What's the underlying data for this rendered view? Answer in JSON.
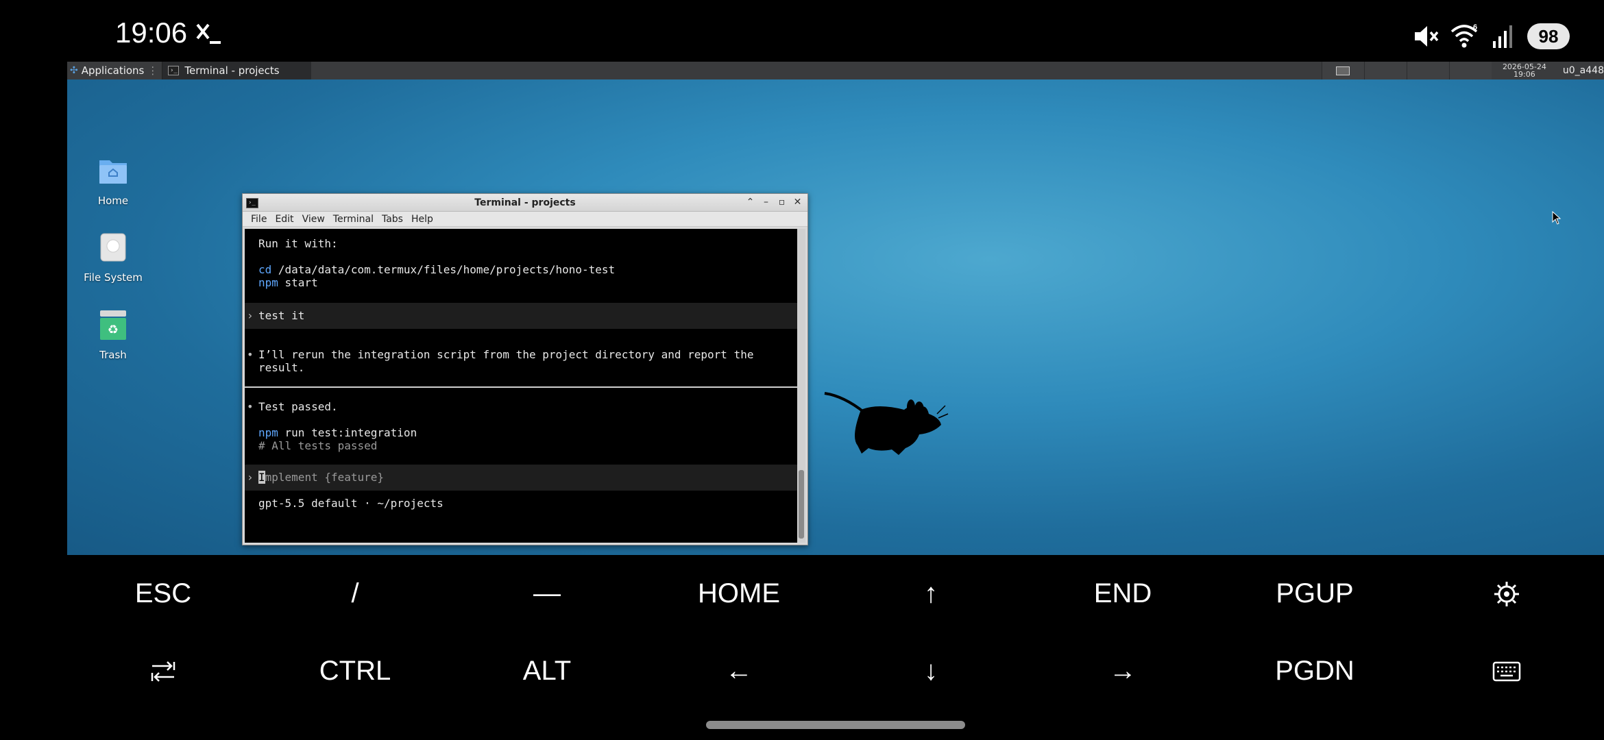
{
  "status_bar": {
    "time": "19:06",
    "battery": "98"
  },
  "panel": {
    "applications_label": "Applications",
    "task_label": "Terminal - projects",
    "clock_date": "2026-05-24",
    "clock_time": "19:06",
    "user": "u0_a448"
  },
  "desktop_icons": [
    {
      "label": "Home"
    },
    {
      "label": "File System"
    },
    {
      "label": "Trash"
    }
  ],
  "window": {
    "title": "Terminal - projects",
    "menu": [
      "File",
      "Edit",
      "View",
      "Terminal",
      "Tabs",
      "Help"
    ]
  },
  "terminal": {
    "run_it_with": "Run it with:",
    "cd_cmd": "cd",
    "cd_path": " /data/data/com.termux/files/home/projects/hono-test",
    "npm_cmd": "npm",
    "npm_start": " start",
    "prompt1_arrow": "›",
    "prompt1_text": "test it",
    "bullet": "•",
    "reply1_line1": "I’ll rerun the integration script from the project directory and report the",
    "reply1_line2": "result.",
    "reply2": "Test passed.",
    "npm_cmd2": "npm",
    "npm_run": " run test:integration",
    "comment": "# All tests passed",
    "prompt2_arrow": "›",
    "input_cursor": "I",
    "input_placeholder": "mplement {feature}",
    "footer": "gpt-5.5 default · ~/projects"
  },
  "keys": {
    "row1": [
      "ESC",
      "/",
      "—",
      "HOME",
      "↑",
      "END",
      "PGUP"
    ],
    "row2": [
      "CTRL",
      "ALT",
      "←",
      "↓",
      "→",
      "PGDN"
    ]
  }
}
